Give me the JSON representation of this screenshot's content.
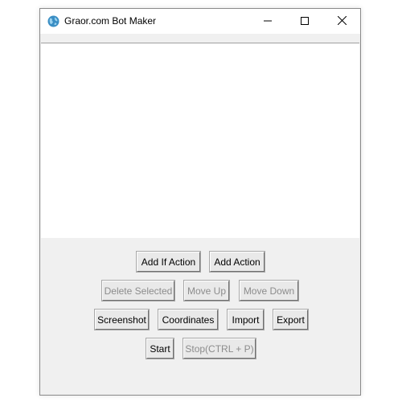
{
  "window": {
    "title": "Graor.com Bot Maker"
  },
  "buttons": {
    "add_if_action": "Add If Action",
    "add_action": "Add Action",
    "delete_selected": "Delete Selected",
    "move_up": "Move Up",
    "move_down": "Move Down",
    "screenshot": "Screenshot",
    "coordinates": "Coordinates",
    "import": "Import",
    "export": "Export",
    "start": "Start",
    "stop": "Stop(CTRL + P)"
  },
  "icons": {
    "app": "globe-icon",
    "minimize": "minimize-icon",
    "maximize": "maximize-icon",
    "close": "close-icon"
  },
  "colors": {
    "window_bg": "#f0f0f0",
    "titlebar_bg": "#ffffff",
    "disabled_text": "#8c8c8c"
  }
}
